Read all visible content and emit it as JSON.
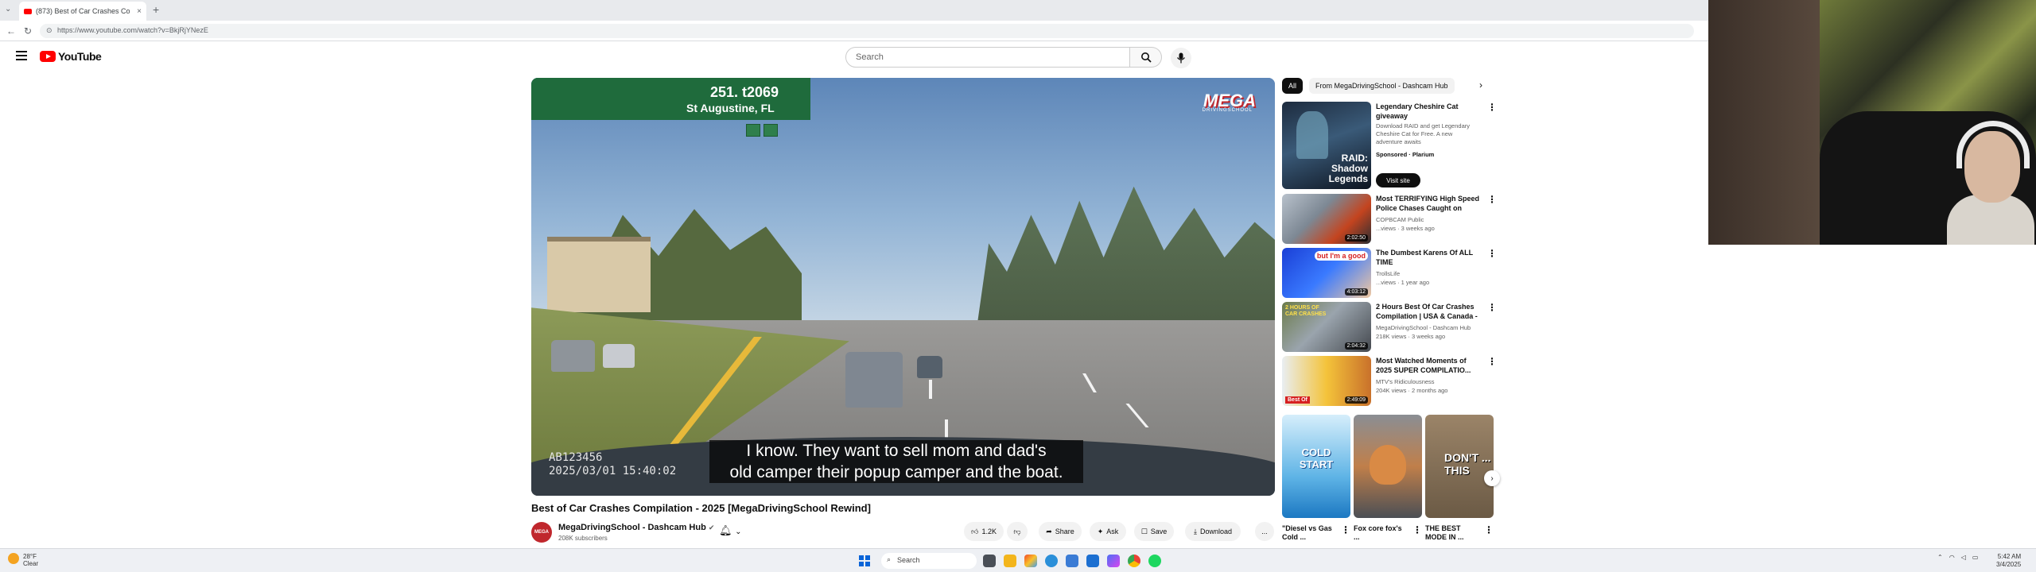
{
  "browser": {
    "tab_title": "(873) Best of Car Crashes Co",
    "tab_close": "×",
    "new_tab": "+",
    "url": "https://www.youtube.com/watch?v=BkjRjYNezE"
  },
  "header": {
    "logo_text": "YouTube",
    "search_placeholder": "Search"
  },
  "video": {
    "sign_road": "251.  t2069",
    "sign_city": "St Augustine, FL",
    "watermark": "MEGA",
    "watermark_sub": "DRIVINGSCHOOL",
    "plate_line": "AB123456",
    "timestamp": "2025/03/01  15:40:02",
    "caption_line1": "I know. They want to sell mom and dad's",
    "caption_line2": "old camper their popup camper and the boat.",
    "title": "Best of Car Crashes Compilation - 2025 [MegaDrivingSchool Rewind]"
  },
  "owner": {
    "avatar_text": "MEGA",
    "name": "MegaDrivingSchool - Dashcam Hub",
    "subscribers": "208K subscribers"
  },
  "actions": {
    "likes": "1.2K",
    "share": "Share",
    "ask": "Ask",
    "save": "Save",
    "download": "Download",
    "more": "..."
  },
  "chips": [
    {
      "label": "All"
    },
    {
      "label": "From MegaDrivingSchool - Dashcam Hub"
    }
  ],
  "recommendations": [
    {
      "title": "Legendary Cheshire Cat giveaway",
      "meta1": "Download RAID and get Legendary Cheshire Cat for Free. A new adventure awaits",
      "meta2": "Sponsored · Plarium",
      "thumb_text": "RAID: Shadow Legends",
      "cta": "Visit site"
    },
    {
      "title": "Most TERRIFYING High Speed Police Chases Caught on Dash...",
      "meta1": "COPBCAM Public",
      "meta2": "...views · 3 weeks ago",
      "duration": "2:02:50"
    },
    {
      "title": "The Dumbest Karens Of ALL TIME",
      "meta1": "TrollsLife",
      "meta2": "...views · 1 year ago",
      "duration": "4:03:12",
      "thumb_text": "but I'm a good"
    },
    {
      "title": "2 Hours Best Of Car Crashes Compilation | USA & Canada - 7",
      "meta1": "MegaDrivingSchool - Dashcam Hub",
      "meta2": "218K views · 3 weeks ago",
      "duration": "2:04:32",
      "thumb_text": "2 HOURS OF CAR CRASHES"
    },
    {
      "title": "Most Watched Moments of 2025 SUPER COMPILATIO...",
      "meta1": "MTV's Ridiculousness",
      "meta2": "204K views · 2 months ago",
      "duration": "2:49:09",
      "thumb_text": "Best Of"
    }
  ],
  "shorts": [
    {
      "title": "\"Diesel vs Gas Cold ...",
      "thumb_text": "COLD START"
    },
    {
      "title": "Fox core fox's ...",
      "thumb_text": ""
    },
    {
      "title": "THE BEST MODE IN ...",
      "thumb_text": "DON'T ... THIS"
    }
  ],
  "taskbar": {
    "weather_temp": "28°F",
    "weather_desc": "Clear",
    "search": "Search",
    "time": "5:42 AM",
    "date": "3/4/2025"
  },
  "colors": {
    "youtube_red": "#ff0000",
    "sign_green": "#1f6b3c",
    "windows_blue": "#0a64d8"
  }
}
